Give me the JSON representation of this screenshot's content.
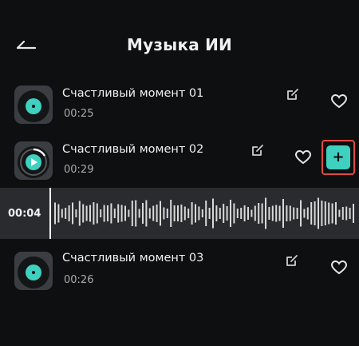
{
  "header": {
    "title": "Музыка ИИ"
  },
  "tracks": [
    {
      "name": "Счастливый момент 01",
      "duration": "00:25"
    },
    {
      "name": "Счастливый момент 02",
      "duration": "00:29"
    },
    {
      "name": "Счастливый момент 03",
      "duration": "00:26"
    }
  ],
  "player": {
    "current_time": "00:04",
    "progress": 0.14
  },
  "add_button": {
    "label": "+"
  },
  "colors": {
    "accent": "#3fd0c0",
    "highlight": "#e04a43",
    "background": "#0e0f11",
    "waveform": "#d9d9d9"
  },
  "icons": {
    "back": "arrow-left-icon",
    "edit": "edit-icon",
    "favorite": "heart-icon",
    "add": "plus-icon"
  }
}
